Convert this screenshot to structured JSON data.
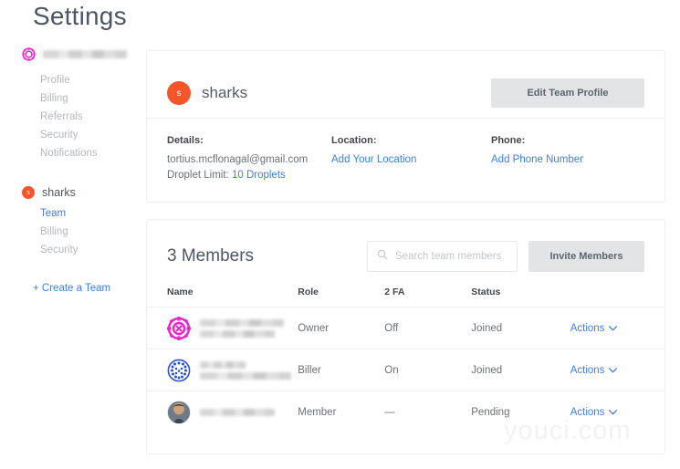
{
  "page": {
    "title": "Settings",
    "watermark": "youci.com"
  },
  "sidebar": {
    "account": {
      "icon": "identicon-magenta-icon",
      "name_redacted": true
    },
    "account_nav": [
      {
        "label": "Profile",
        "active": false
      },
      {
        "label": "Billing",
        "active": false
      },
      {
        "label": "Referrals",
        "active": false
      },
      {
        "label": "Security",
        "active": false
      },
      {
        "label": "Notifications",
        "active": false
      }
    ],
    "team": {
      "name": "sharks",
      "avatar_letter": "s",
      "avatar_color": "#f4562a"
    },
    "team_nav": [
      {
        "label": "Team",
        "active": true
      },
      {
        "label": "Billing",
        "active": false
      },
      {
        "label": "Security",
        "active": false
      }
    ],
    "create_team_label": "+ Create a Team"
  },
  "profile_card": {
    "team_name": "sharks",
    "team_avatar_letter": "s",
    "edit_button_label": "Edit Team Profile",
    "details": {
      "label": "Details:",
      "email": "tortius.mcflonagal@gmail.com",
      "droplet_limit_label": "Droplet Limit:",
      "droplet_limit_value": "10 Droplets"
    },
    "location": {
      "label": "Location:",
      "link": "Add Your Location"
    },
    "phone": {
      "label": "Phone:",
      "link": "Add Phone Number"
    }
  },
  "members_card": {
    "title": "3 Members",
    "search": {
      "placeholder": "Search team members",
      "value": "",
      "icon": "search-icon"
    },
    "invite_button_label": "Invite Members",
    "columns": [
      "Name",
      "Role",
      "2 FA",
      "Status",
      ""
    ],
    "rows": [
      {
        "avatar": "identicon-magenta-icon",
        "name_redacted": true,
        "role": "Owner",
        "two_fa": "Off",
        "status": "Joined",
        "actions_label": "Actions"
      },
      {
        "avatar": "identicon-blue-icon",
        "name_redacted": true,
        "role": "Biller",
        "two_fa": "On",
        "status": "Joined",
        "actions_label": "Actions"
      },
      {
        "avatar": "photo-avatar-icon",
        "name_redacted": true,
        "role": "Member",
        "two_fa": "—",
        "status": "Pending",
        "actions_label": "Actions"
      }
    ]
  },
  "colors": {
    "link": "#3b7ef4",
    "accent_orange": "#f4562a",
    "identicon_magenta": "#ef23c8",
    "identicon_blue": "#2b50c8",
    "text_muted": "#b4b8bd",
    "border": "#eceef0"
  }
}
